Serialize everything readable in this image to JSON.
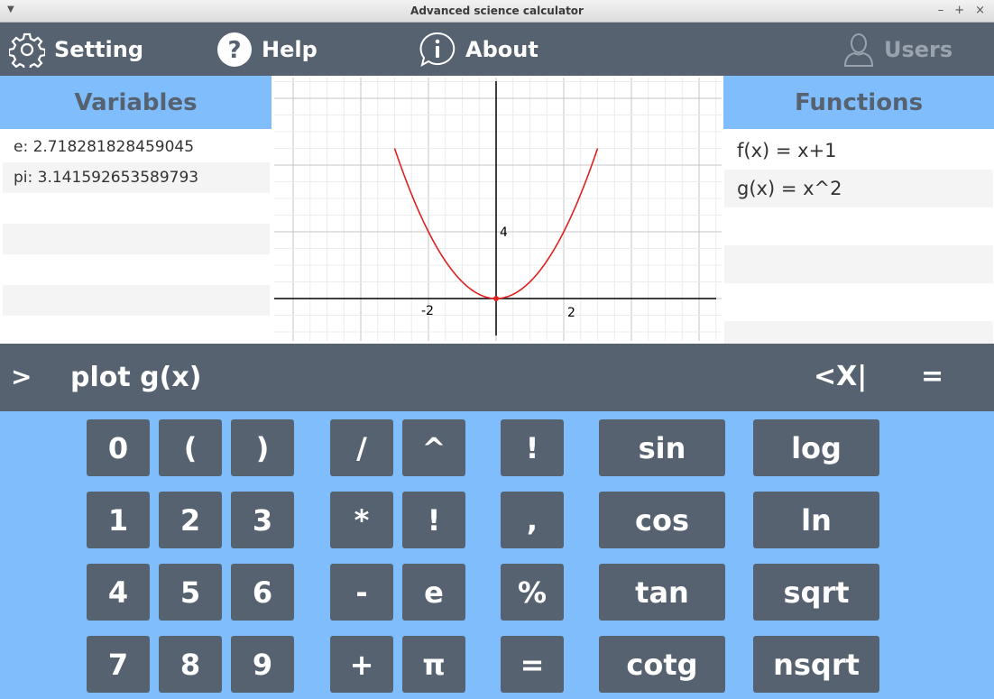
{
  "window": {
    "title": "Advanced science calculator"
  },
  "nav": {
    "setting": "Setting",
    "help": "Help",
    "about": "About",
    "users": "Users"
  },
  "variables": {
    "title": "Variables",
    "items": [
      "e: 2.718281828459045",
      "pi: 3.141592653589793",
      "",
      "",
      "",
      ""
    ]
  },
  "functions": {
    "title": "Functions",
    "items": [
      "f(x) = x+1",
      "g(x) = x^2",
      "",
      "",
      "",
      ""
    ]
  },
  "graph": {
    "x_tick_labels": [
      "-2",
      "2"
    ],
    "y_tick_labels": [
      "4"
    ],
    "curve_color": "#e02020",
    "function": "x^2"
  },
  "command": {
    "prompt": ">",
    "value": "plot g(x)",
    "clear_label": "<X|",
    "equals_label": "="
  },
  "keypad": {
    "col1": [
      "0",
      "1",
      "4",
      "7"
    ],
    "col2": [
      "(",
      "2",
      "5",
      "8"
    ],
    "col3": [
      ")",
      "3",
      "6",
      "9"
    ],
    "col4": [
      "/",
      "*",
      "-",
      "+"
    ],
    "col5": [
      "^",
      "!",
      "e",
      "π"
    ],
    "col6": [
      "!",
      ",",
      "%",
      "="
    ],
    "col7": [
      "sin",
      "cos",
      "tan",
      "cotg"
    ],
    "col8": [
      "log",
      "ln",
      "sqrt",
      "nsqrt"
    ]
  },
  "colors": {
    "dark": "#566270",
    "accent": "#80bdfd"
  }
}
